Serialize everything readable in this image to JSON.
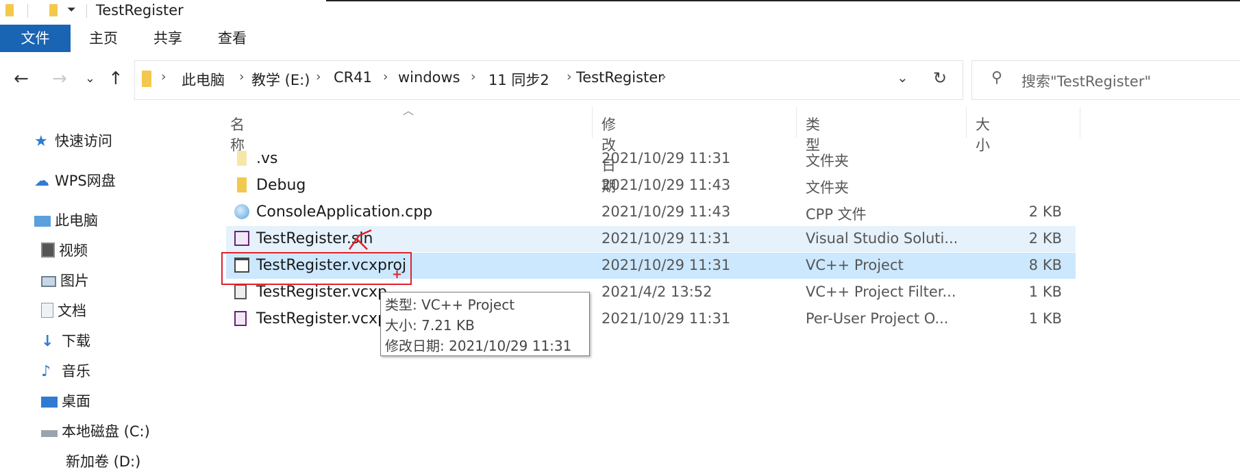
{
  "window": {
    "title": "TestRegister"
  },
  "ribbon": {
    "tabs": [
      "文件",
      "主页",
      "共享",
      "查看"
    ]
  },
  "address": {
    "segments": [
      "此电脑",
      "教学 (E:)",
      "CR41",
      "windows",
      "11 同步2",
      "TestRegister"
    ]
  },
  "search": {
    "placeholder": "搜索\"TestRegister\""
  },
  "sidebar": {
    "items": [
      {
        "label": "快速访问",
        "icon": "star-icon"
      },
      {
        "label": "WPS网盘",
        "icon": "cloud-icon"
      },
      {
        "label": "此电脑",
        "icon": "computer-icon"
      },
      {
        "label": "视频",
        "icon": "video-icon"
      },
      {
        "label": "图片",
        "icon": "picture-icon"
      },
      {
        "label": "文档",
        "icon": "document-icon"
      },
      {
        "label": "下载",
        "icon": "download-icon"
      },
      {
        "label": "音乐",
        "icon": "music-icon"
      },
      {
        "label": "桌面",
        "icon": "desktop-icon"
      },
      {
        "label": "本地磁盘 (C:)",
        "icon": "drive-icon"
      },
      {
        "label": "新加卷 (D:)",
        "icon": "drive-icon"
      }
    ]
  },
  "columns": {
    "name": "名称",
    "modified": "修改日期",
    "type": "类型",
    "size": "大小"
  },
  "files": [
    {
      "name": ".vs",
      "modified": "2021/10/29 11:31",
      "type": "文件夹",
      "size": "",
      "icon": "folder-icon"
    },
    {
      "name": "Debug",
      "modified": "2021/10/29 11:43",
      "type": "文件夹",
      "size": "",
      "icon": "folder-icon"
    },
    {
      "name": "ConsoleApplication.cpp",
      "modified": "2021/10/29 11:43",
      "type": "CPP 文件",
      "size": "2 KB",
      "icon": "cpp-file-icon"
    },
    {
      "name": "TestRegister.sln",
      "modified": "2021/10/29 11:31",
      "type": "Visual Studio Soluti...",
      "size": "2 KB",
      "icon": "solution-file-icon"
    },
    {
      "name": "TestRegister.vcxproj",
      "modified": "2021/10/29 11:31",
      "type": "VC++ Project",
      "size": "8 KB",
      "icon": "vcxproj-file-icon"
    },
    {
      "name": "TestRegister.vcxp",
      "modified": "2021/4/2 13:52",
      "type": "VC++ Project Filter...",
      "size": "1 KB",
      "icon": "filters-file-icon"
    },
    {
      "name": "TestRegister.vcxp",
      "modified": "2021/10/29 11:31",
      "type": "Per-User Project O...",
      "size": "1 KB",
      "icon": "user-file-icon"
    }
  ],
  "tooltip": {
    "type_line": "类型: VC++ Project",
    "size_line": "大小: 7.21 KB",
    "date_line": "修改日期: 2021/10/29 11:31"
  },
  "colors": {
    "accent": "#1a64b4",
    "selection": "#cce8ff",
    "hover": "#e5f1fb",
    "annotation": "#e0202a"
  }
}
